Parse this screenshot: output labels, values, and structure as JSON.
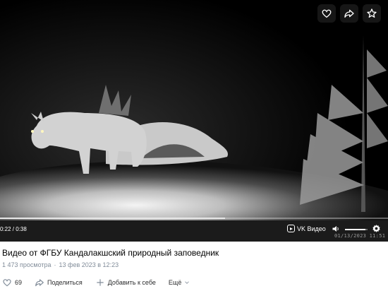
{
  "player": {
    "time_display": "0:22 / 0:38",
    "progress": 0.58,
    "volume": 0.92,
    "brand_label": "VK Видео",
    "camera_timestamp": "01/13/2023 11:51"
  },
  "top_actions": [
    "heart-icon",
    "share-icon",
    "star-icon"
  ],
  "video": {
    "title": "Видео от ФГБУ Кандалакшский природный заповедник",
    "views": "1 473 просмотра",
    "date": "13 фев 2023 в 12:23"
  },
  "actions": {
    "likes_count": "69",
    "share_label": "Поделиться",
    "add_label": "Добавить к себе",
    "more_label": "Ещё"
  },
  "colors": {
    "secondary_text": "#818c99",
    "primary_text": "#000000",
    "player_bg": "#000000"
  }
}
